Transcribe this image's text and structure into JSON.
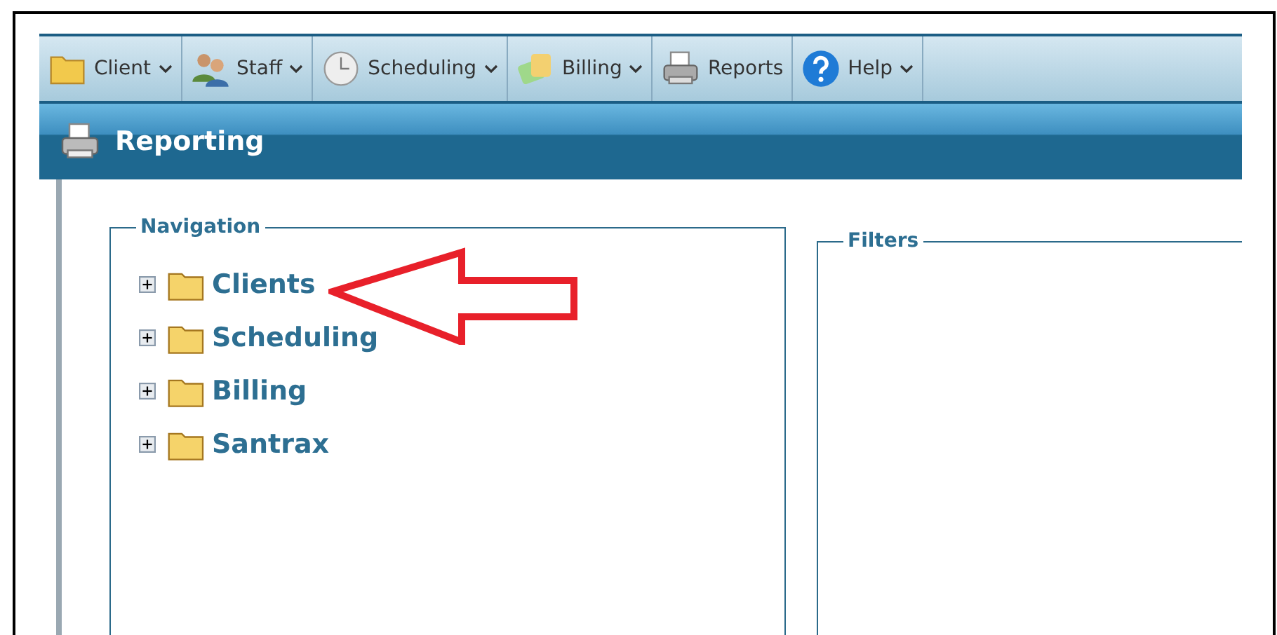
{
  "menu": [
    {
      "label": "Client",
      "kind": "folder",
      "dropdown": true
    },
    {
      "label": "Staff",
      "kind": "people",
      "dropdown": true
    },
    {
      "label": "Scheduling",
      "kind": "clock",
      "dropdown": true
    },
    {
      "label": "Billing",
      "kind": "money",
      "dropdown": true
    },
    {
      "label": "Reports",
      "kind": "printer",
      "dropdown": false
    },
    {
      "label": "Help",
      "kind": "help",
      "dropdown": true
    }
  ],
  "header": {
    "title": "Reporting"
  },
  "navigation": {
    "title": "Navigation",
    "items": [
      {
        "label": "Clients",
        "expanded": false
      },
      {
        "label": "Scheduling",
        "expanded": false
      },
      {
        "label": "Billing",
        "expanded": false
      },
      {
        "label": "Santrax",
        "expanded": false
      }
    ]
  },
  "filters": {
    "title": "Filters"
  }
}
